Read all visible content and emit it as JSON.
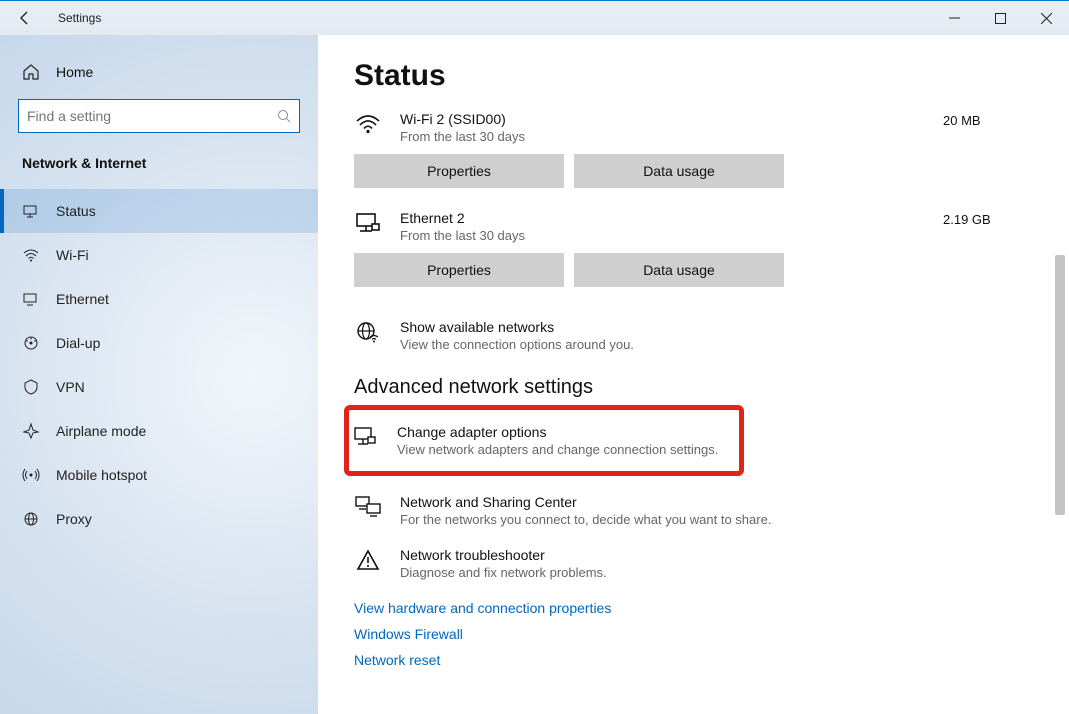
{
  "window": {
    "title": "Settings"
  },
  "sidebar": {
    "home": "Home",
    "search_placeholder": "Find a setting",
    "category": "Network & Internet",
    "items": [
      {
        "label": "Status",
        "icon": "status-icon",
        "active": true
      },
      {
        "label": "Wi-Fi",
        "icon": "wifi-icon"
      },
      {
        "label": "Ethernet",
        "icon": "ethernet-icon"
      },
      {
        "label": "Dial-up",
        "icon": "dialup-icon"
      },
      {
        "label": "VPN",
        "icon": "vpn-icon"
      },
      {
        "label": "Airplane mode",
        "icon": "airplane-icon"
      },
      {
        "label": "Mobile hotspot",
        "icon": "hotspot-icon"
      },
      {
        "label": "Proxy",
        "icon": "proxy-icon"
      }
    ]
  },
  "main": {
    "title": "Status",
    "networks": [
      {
        "name": "Wi-Fi 2 (SSID00)",
        "sub": "From the last 30 days",
        "meta": "20 MB"
      },
      {
        "name": "Ethernet 2",
        "sub": "From the last 30 days",
        "meta": "2.19 GB"
      }
    ],
    "buttons": {
      "properties": "Properties",
      "data_usage": "Data usage"
    },
    "show_available": {
      "title": "Show available networks",
      "sub": "View the connection options around you."
    },
    "advanced_heading": "Advanced network settings",
    "advanced": [
      {
        "title": "Change adapter options",
        "sub": "View network adapters and change connection settings.",
        "highlight": true
      },
      {
        "title": "Network and Sharing Center",
        "sub": "For the networks you connect to, decide what you want to share."
      },
      {
        "title": "Network troubleshooter",
        "sub": "Diagnose and fix network problems."
      }
    ],
    "links": [
      "View hardware and connection properties",
      "Windows Firewall",
      "Network reset"
    ]
  }
}
